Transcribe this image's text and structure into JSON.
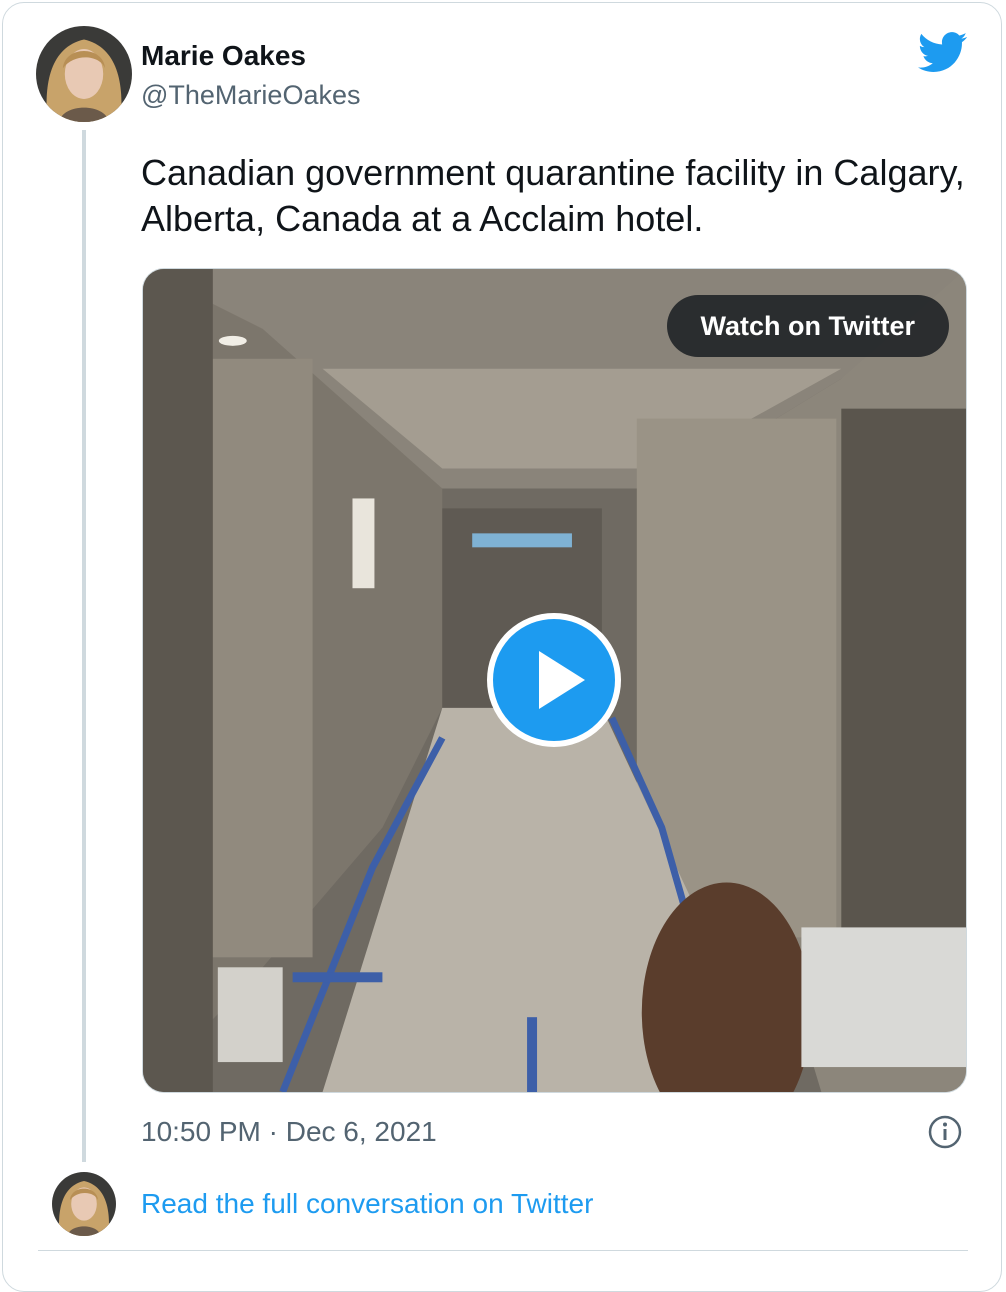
{
  "tweet": {
    "author_name": "Marie Oakes",
    "author_handle": "@TheMarieOakes",
    "text": "Canadian government quarantine facility in Calgary, Alberta, Canada at a Acclaim hotel.",
    "timestamp": "10:50 PM · Dec 6, 2021",
    "brand_icon": "twitter-bird-icon",
    "brand_color": "#1d9bf0"
  },
  "media": {
    "watch_label": "Watch on Twitter",
    "play_icon": "play-icon",
    "play_color": "#1d9bf0"
  },
  "footer": {
    "read_conversation_label": "Read the full conversation on Twitter",
    "info_icon": "info-icon",
    "link_color": "#1d9bf0"
  }
}
